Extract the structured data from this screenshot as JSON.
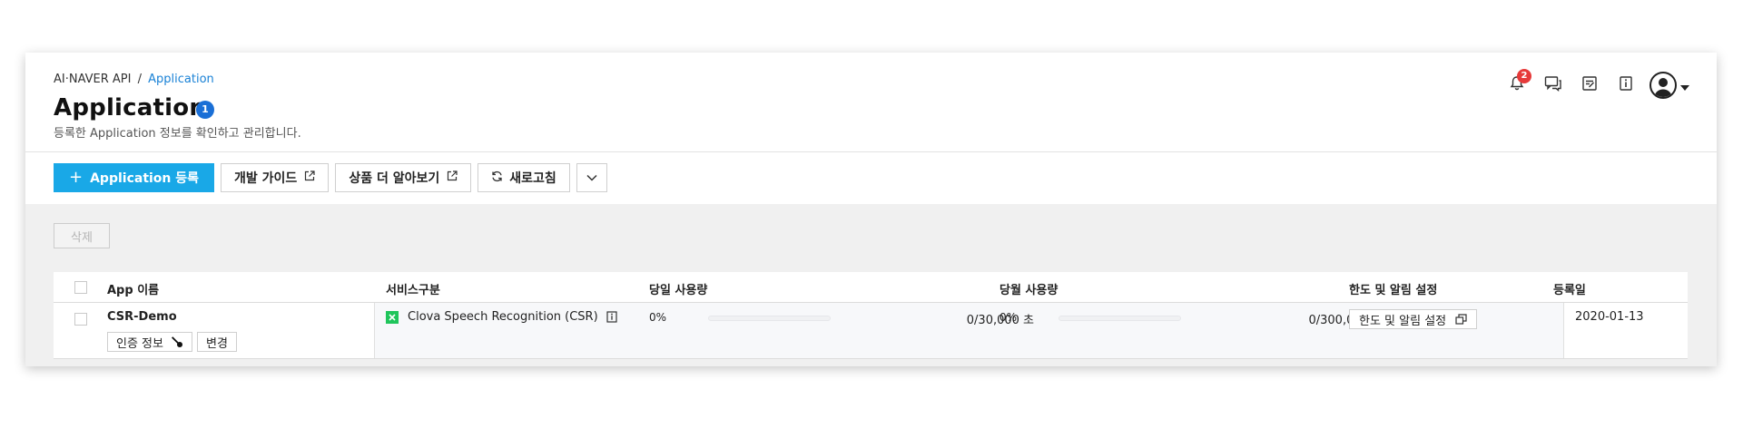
{
  "breadcrumb": {
    "root": "AI·NAVER API",
    "separator": "/",
    "current": "Application"
  },
  "page": {
    "title": "Application",
    "count_badge": "1",
    "subtitle": "등록한 Application 정보를 확인하고 관리합니다."
  },
  "topbar": {
    "icons": [
      "bell-icon",
      "chat-icon",
      "memo-icon",
      "info-icon",
      "user-avatar-icon",
      "caret-down-icon"
    ],
    "notification_count": "2"
  },
  "toolbar": {
    "add_label": "Application 등록",
    "guide_label": "개발 가이드",
    "more_label": "상품 더 알아보기",
    "refresh_label": "새로고침"
  },
  "actions": {
    "delete_label": "삭제"
  },
  "table": {
    "columns": {
      "app_name": "App 이름",
      "service": "서비스구분",
      "daily_usage": "당일 사용량",
      "monthly_usage": "당월 사용량",
      "limit_settings": "한도 및 알림 설정",
      "registered": "등록일"
    },
    "rows": [
      {
        "app_name": "CSR-Demo",
        "auth_label": "인증 정보",
        "edit_label": "변경",
        "service": "Clova Speech Recognition (CSR)",
        "daily_percent": "0%",
        "daily_usage": "0/30,000 초",
        "daily_fill": 0,
        "monthly_percent": "0%",
        "monthly_usage": "0/300,000 초",
        "monthly_fill": 0,
        "limit_button": "한도 및 알림 설정",
        "registered": "2020-01-13"
      }
    ]
  },
  "colors": {
    "primary": "#19a8e7",
    "link": "#1a82d6",
    "badge": "#1a6fd6",
    "notification": "#e63a3a",
    "service_icon": "#1fc55b"
  }
}
